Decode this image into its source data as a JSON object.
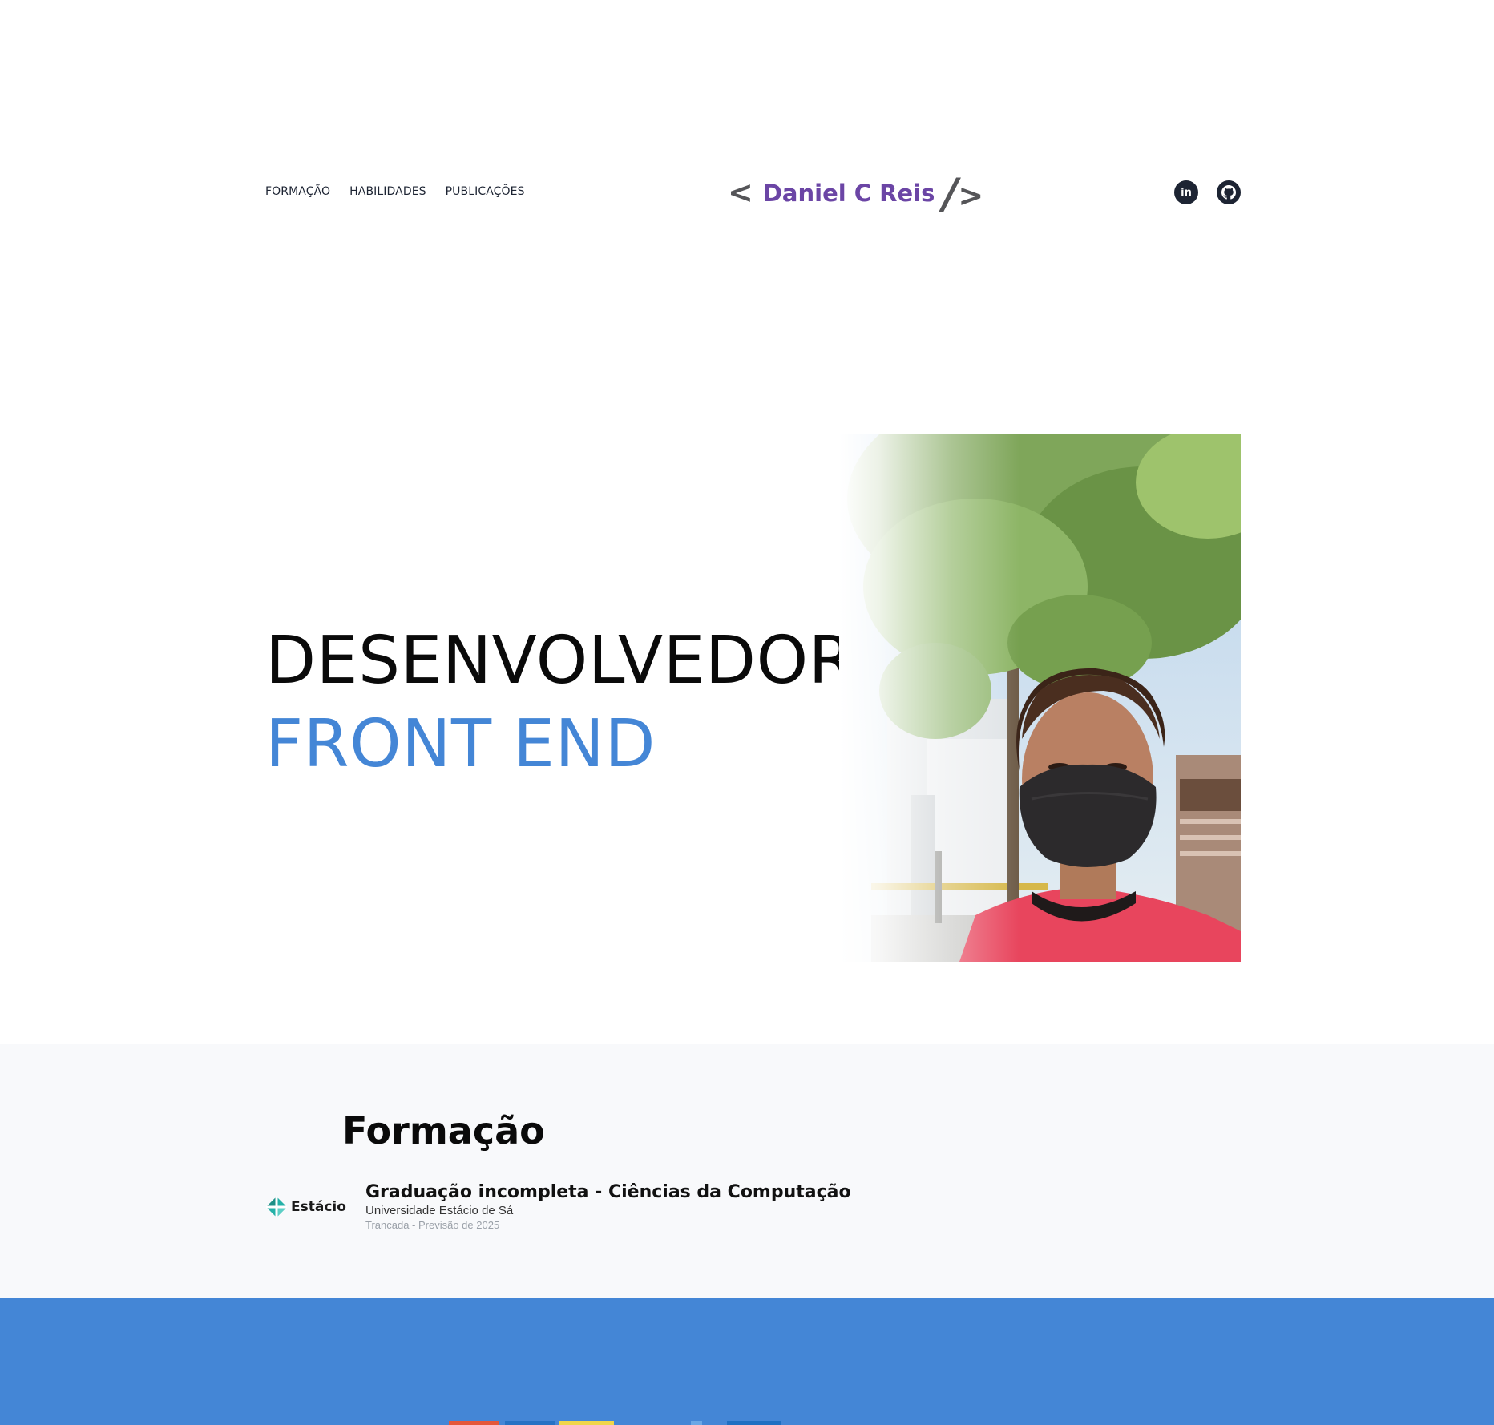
{
  "nav": {
    "links": [
      {
        "label": "FORMAÇÃO"
      },
      {
        "label": "HABILIDADES"
      },
      {
        "label": "PUBLICAÇÕES"
      }
    ],
    "logo": {
      "open": "<",
      "name": "Daniel C Reis",
      "slash": "/",
      "close": ">"
    },
    "socials": [
      {
        "icon": "linkedin-icon",
        "glyph": "in"
      },
      {
        "icon": "github-icon"
      }
    ]
  },
  "hero": {
    "line1": "DESENVOLVEDOR",
    "line2": "FRONT END",
    "photo_alt": "profile-photo"
  },
  "formacao": {
    "title": "Formação",
    "items": [
      {
        "logo_text": "Estácio",
        "title": "Graduação incompleta - Ciências da Computação",
        "school": "Universidade Estácio de Sá",
        "status": "Trancada - Previsão de 2025"
      }
    ]
  },
  "colors": {
    "accent_blue": "#4486d6",
    "logo_purple": "#6b45a5",
    "dark": "#1d2433",
    "section_bg": "#f8f9fb"
  }
}
